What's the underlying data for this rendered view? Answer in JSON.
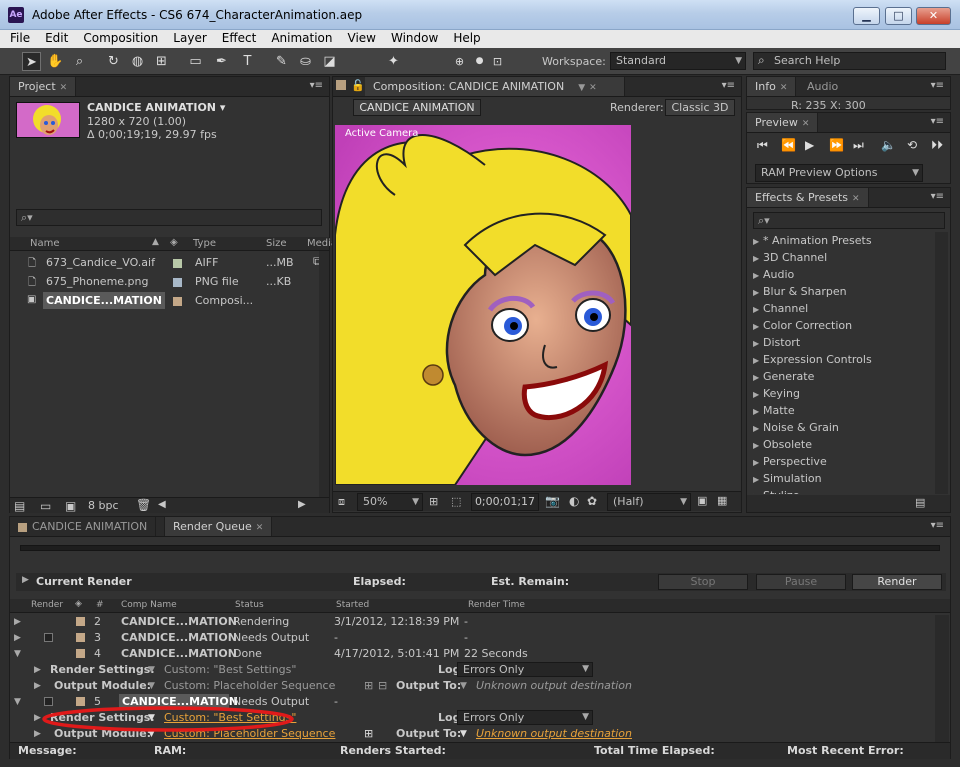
{
  "app": {
    "logo": "Ae",
    "title": "Adobe After Effects - CS6 674_CharacterAnimation.aep"
  },
  "window_controls": {
    "minimize": "▁",
    "maximize": "□",
    "close": "✕"
  },
  "menu": [
    "File",
    "Edit",
    "Composition",
    "Layer",
    "Effect",
    "Animation",
    "View",
    "Window",
    "Help"
  ],
  "toolbar": {
    "tools": [
      "selection-tool-icon",
      "hand-tool-icon",
      "zoom-tool-icon",
      "rotate-tool-icon",
      "camera-orbit-icon",
      "pan-behind-icon",
      "rectangle-mask-icon",
      "pen-tool-icon",
      "type-tool-icon",
      "brush-tool-icon",
      "clone-stamp-icon",
      "eraser-icon",
      "puppet-pin-icon"
    ],
    "workspace_label": "Workspace:",
    "workspace_value": "Standard",
    "search_placeholder": "Search Help"
  },
  "project": {
    "tab": "Project",
    "comp_name": "CANDICE ANIMATION ▾",
    "comp_res": "1280 x 720 (1.00)",
    "comp_dur": "Δ 0;00;19;19, 29.97 fps",
    "search_icon": "⌕▾",
    "columns": {
      "name": "Name",
      "type": "Type",
      "size": "Size",
      "media": "Media"
    },
    "items": [
      {
        "name": "673_Candice_VO.aif",
        "type": "AIFF",
        "size": "...MB",
        "color": "#b8c8a8"
      },
      {
        "name": "675_Phoneme.png",
        "type": "PNG file",
        "size": "...KB",
        "color": "#a8b8c8"
      },
      {
        "name": "CANDICE...MATION",
        "type": "Composi...",
        "size": "",
        "color": "#c4a888"
      }
    ],
    "bpc": "8 bpc"
  },
  "composition": {
    "tab": "Composition: CANDICE ANIMATION",
    "comp_button": "CANDICE ANIMATION",
    "renderer_label": "Renderer:",
    "renderer_value": "Classic 3D",
    "view_label": "Active Camera",
    "zoom": "50%",
    "timecode": "0;00;01;17",
    "resolution": "(Half)",
    "bg_color": "#e054d2"
  },
  "info": {
    "tabs": [
      "Info",
      "Audio"
    ],
    "readout": "R: 235     X: 300"
  },
  "preview": {
    "tab": "Preview",
    "controls": [
      "first-frame-icon",
      "previous-frame-icon",
      "play-icon",
      "next-frame-icon",
      "last-frame-icon",
      "audio-icon",
      "loop-icon",
      "ram-preview-icon"
    ],
    "ram_options": "RAM Preview Options"
  },
  "effects": {
    "tab": "Effects & Presets",
    "search_icon": "⌕▾",
    "items": [
      "* Animation Presets",
      "3D Channel",
      "Audio",
      "Blur & Sharpen",
      "Channel",
      "Color Correction",
      "Distort",
      "Expression Controls",
      "Generate",
      "Keying",
      "Matte",
      "Noise & Grain",
      "Obsolete",
      "Perspective",
      "Simulation",
      "Stylize"
    ]
  },
  "bottom_tabs": [
    "CANDICE ANIMATION",
    "Render Queue"
  ],
  "render_queue": {
    "current_render": "Current Render",
    "elapsed": "Elapsed:",
    "est_remain": "Est. Remain:",
    "stop": "Stop",
    "pause": "Pause",
    "render": "Render",
    "columns": {
      "render": "Render",
      "num": "#",
      "comp": "Comp Name",
      "status": "Status",
      "started": "Started",
      "time": "Render Time"
    },
    "rows": [
      {
        "num": "2",
        "comp": "CANDICE...MATION",
        "status": "Rendering",
        "started": "3/1/2012, 12:18:39 PM",
        "time": "-"
      },
      {
        "num": "3",
        "comp": "CANDICE...MATION",
        "status": "Needs Output",
        "started": "-",
        "time": "-"
      },
      {
        "num": "4",
        "comp": "CANDICE...MATION",
        "status": "Done",
        "started": "4/17/2012, 5:01:41 PM",
        "time": "22 Seconds"
      }
    ],
    "settings_label": "Render Settings:",
    "settings_value": "Custom: \"Best Settings\"",
    "log_label": "Log:",
    "log_value": "Errors Only",
    "output_module_label": "Output Module:",
    "output_module_value": "Custom: Placeholder Sequence",
    "output_to_label": "Output To:",
    "output_to_value": "Unknown output destination",
    "row5": {
      "num": "5",
      "comp": "CANDICE...MATION",
      "status": "Needs Output",
      "started": "-"
    },
    "footer": {
      "message": "Message:",
      "ram": "RAM:",
      "renders_started": "Renders Started:",
      "total_time": "Total Time Elapsed:",
      "recent_error": "Most Recent Error:"
    }
  },
  "colors": {
    "highlight_oval": "#e01a1a",
    "orange": "#e8a23a"
  }
}
